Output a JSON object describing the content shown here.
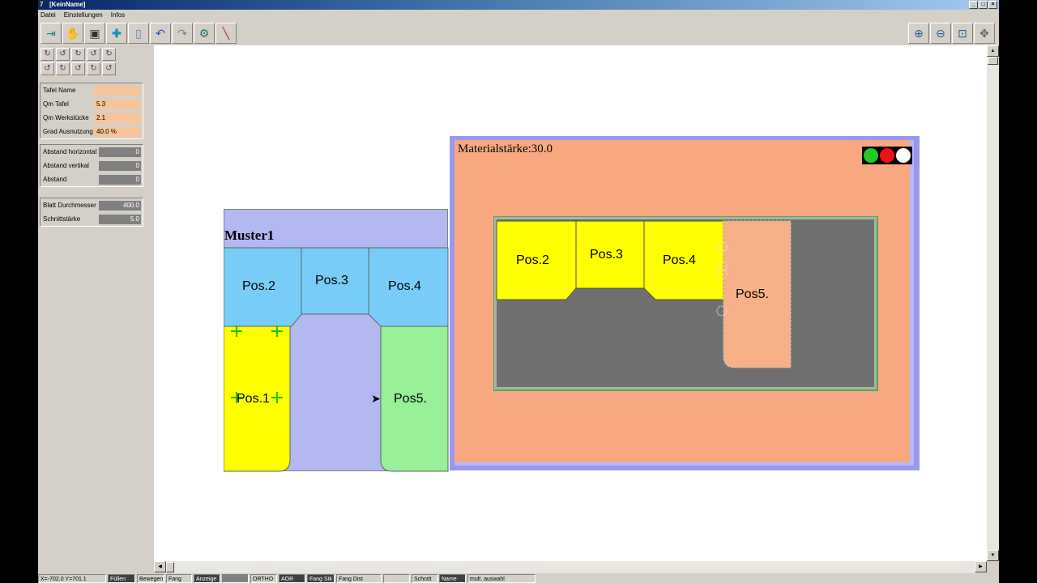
{
  "window": {
    "title": "[KeinName]",
    "app_icon": "7"
  },
  "menu": [
    "Datei",
    "Einstellungen",
    "Infos"
  ],
  "toolbar": {
    "left_icons": [
      "exit-icon",
      "pointer-icon",
      "save-icon",
      "add-icon",
      "new-page-icon",
      "undo-icon",
      "redo-icon",
      "settings-icon",
      "line-tool-icon"
    ],
    "right_icons": [
      "zoom-in-icon",
      "zoom-out-icon",
      "zoom-window-icon",
      "pan-icon"
    ]
  },
  "rotation_buttons": [
    "↻",
    "↺",
    "↻",
    "↺",
    "↻",
    "↺",
    "↻",
    "↺",
    "↻",
    "↺"
  ],
  "fields_group1": [
    {
      "label": "Tafel Name",
      "value": ""
    },
    {
      "label": "Qm Tafel",
      "value": "5.3"
    },
    {
      "label": "Qm Werkstücke",
      "value": "2.1"
    },
    {
      "label": "Grad Ausnutzung",
      "value": "40.0 %"
    }
  ],
  "fields_group2": [
    {
      "label": "Abstand horizontal",
      "value": "0"
    },
    {
      "label": "Abstand vertikal",
      "value": "0"
    },
    {
      "label": "Abstand",
      "value": "0"
    }
  ],
  "fields_group3": [
    {
      "label": "Blatt Durchmesser",
      "value": "400.0"
    },
    {
      "label": "Schnittstärke",
      "value": "5.0"
    }
  ],
  "muster": {
    "title": "Muster1",
    "parts": [
      "Pos.2",
      "Pos.3",
      "Pos.4",
      "Pos.1",
      "Pos5."
    ]
  },
  "sheet": {
    "title": "Materialstärke:30.0",
    "parts": [
      "Pos.2",
      "Pos.3",
      "Pos.4",
      "Pos5."
    ],
    "traffic_light": [
      "#22cc22",
      "#ee1111",
      "#ffffff"
    ]
  },
  "status": {
    "coords": "X=-702.0 Y=701.1",
    "items": [
      "Füllen",
      "Bewegen",
      "Fang",
      "Anzeige",
      "",
      "ORTHO",
      "AOR",
      "Fang Stk",
      "Fang Dist",
      "",
      "Schnitt",
      "Name",
      "mult. auswahl"
    ]
  },
  "colors": {
    "muster_bg": "#b4b8f0",
    "blue_part": "#78ccf8",
    "yellow_part": "#ffff00",
    "green_part": "#98f098",
    "sheet_bg": "#f8a880",
    "sheet_border": "#9898f0",
    "dark_area": "#707070"
  }
}
